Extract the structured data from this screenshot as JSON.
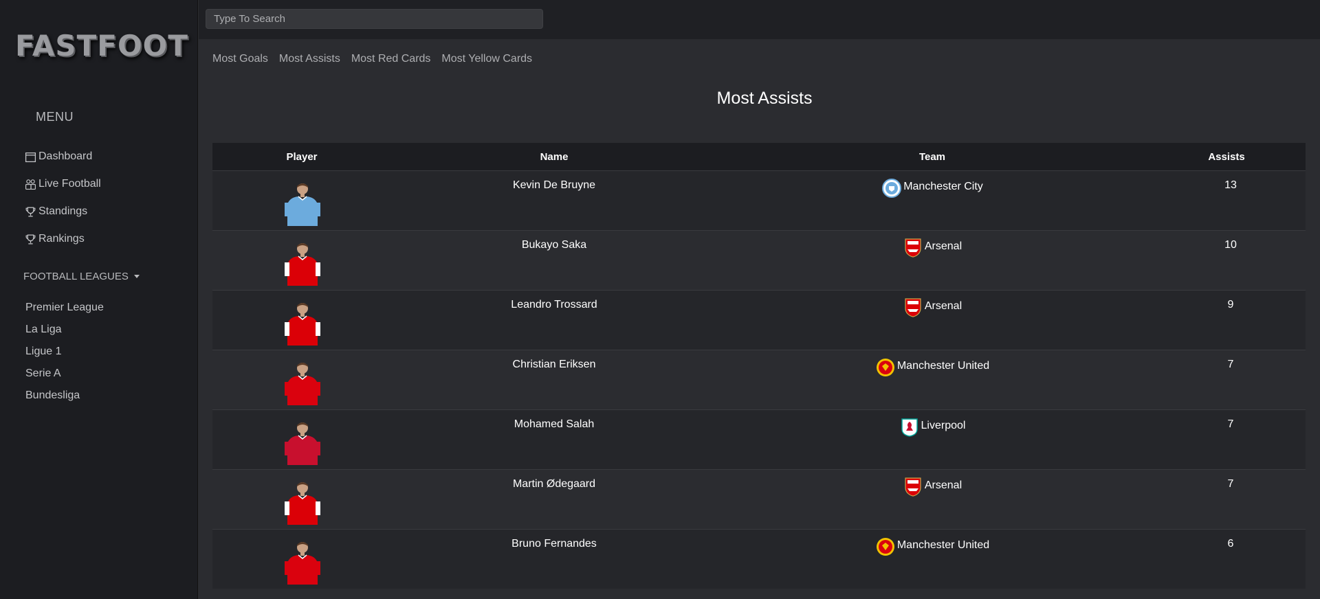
{
  "brand": {
    "logo_text": "FASTFOOT"
  },
  "search": {
    "placeholder": "Type To Search"
  },
  "sidebar": {
    "menu_title": "MENU",
    "items": [
      {
        "label": "Dashboard",
        "icon": "calendar-icon"
      },
      {
        "label": "Live Football",
        "icon": "people-icon"
      },
      {
        "label": "Standings",
        "icon": "trophy-icon"
      },
      {
        "label": "Rankings",
        "icon": "trophy-icon"
      }
    ],
    "leagues_title": "FOOTBALL LEAGUES",
    "leagues": [
      "Premier League",
      "La Liga",
      "Ligue 1",
      "Serie A",
      "Bundesliga"
    ]
  },
  "tabs": [
    "Most Goals",
    "Most Assists",
    "Most Red Cards",
    "Most Yellow Cards"
  ],
  "page_title": "Most Assists",
  "table": {
    "headers": [
      "Player",
      "Name",
      "Team",
      "Assists"
    ],
    "rows": [
      {
        "name": "Kevin De Bruyne",
        "team": "Manchester City",
        "assists": "13",
        "kit": "#6cabdd",
        "crest": "city"
      },
      {
        "name": "Bukayo Saka",
        "team": "Arsenal",
        "assists": "10",
        "kit": "#db0007",
        "crest": "arsenal"
      },
      {
        "name": "Leandro Trossard",
        "team": "Arsenal",
        "assists": "9",
        "kit": "#db0007",
        "crest": "arsenal"
      },
      {
        "name": "Christian Eriksen",
        "team": "Manchester United",
        "assists": "7",
        "kit": "#da020e",
        "crest": "united"
      },
      {
        "name": "Mohamed Salah",
        "team": "Liverpool",
        "assists": "7",
        "kit": "#c8102e",
        "crest": "liverpool"
      },
      {
        "name": "Martin Ødegaard",
        "team": "Arsenal",
        "assists": "7",
        "kit": "#db0007",
        "crest": "arsenal"
      },
      {
        "name": "Bruno Fernandes",
        "team": "Manchester United",
        "assists": "6",
        "kit": "#da020e",
        "crest": "united"
      }
    ]
  }
}
